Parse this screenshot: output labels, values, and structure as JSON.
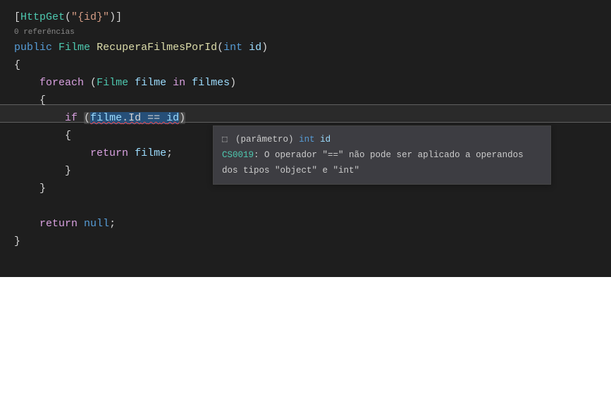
{
  "code": {
    "attribute_open": "[",
    "attribute_name": "HttpGet",
    "attribute_paren_open": "(",
    "attribute_arg": "\"{id}\"",
    "attribute_paren_close": ")",
    "attribute_close": "]",
    "codelens": "0 referências",
    "access": "public",
    "return_type": "Filme",
    "method_name": "RecuperaFilmesPorId",
    "param_open": "(",
    "param_type": "int",
    "param_name": "id",
    "param_close": ")",
    "brace_open": "{",
    "foreach_kw": "foreach",
    "foreach_open": "(",
    "foreach_type": "Filme",
    "foreach_var": "filme",
    "in_kw": "in",
    "foreach_collection": "filmes",
    "foreach_close": ")",
    "inner_brace_open": "{",
    "if_kw": "if",
    "if_open": "(",
    "if_left": "filme",
    "if_dot": ".",
    "if_prop": "Id",
    "if_op": "==",
    "if_right": "id",
    "if_close": ")",
    "if_brace_open": "{",
    "return_kw": "return",
    "return_var": "filme",
    "semicolon": ";",
    "if_brace_close": "}",
    "inner_brace_close": "}",
    "return2_kw": "return",
    "null_kw": "null",
    "brace_close": "}"
  },
  "tooltip": {
    "param_icon": "⬚",
    "param_label": "(parâmetro)",
    "param_type": "int",
    "param_name": "id",
    "error_code": "CS0019",
    "error_sep": ": ",
    "error_msg": "O operador \"==\" não pode ser aplicado a operandos dos tipos \"object\" e \"int\""
  }
}
